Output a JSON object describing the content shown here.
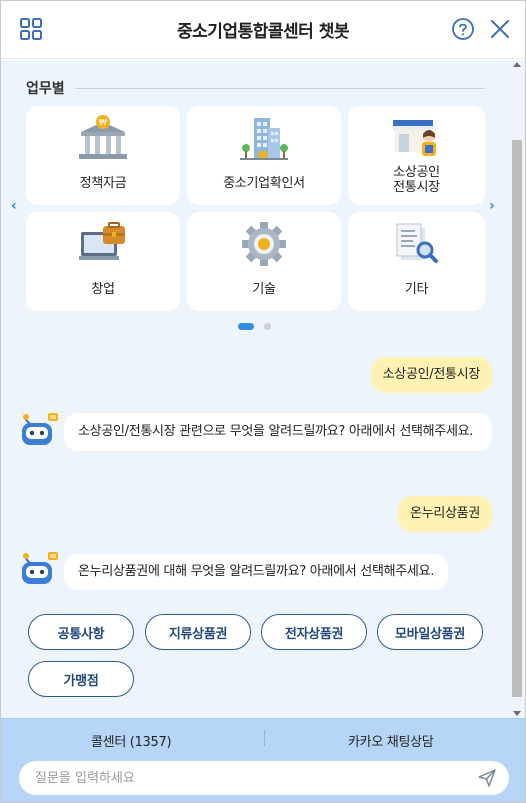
{
  "header": {
    "title": "중소기업통합콜센터 챗봇",
    "menu_icon": "grid-icon",
    "help_icon": "help-circle-icon",
    "close_icon": "close-icon"
  },
  "category": {
    "title": "업무별",
    "cards": [
      {
        "label": "정책자금",
        "icon": "bank-icon"
      },
      {
        "label": "중소기업확인서",
        "icon": "building-icon"
      },
      {
        "label": "소상공인\n전통시장",
        "icon": "shop-icon"
      },
      {
        "label": "창업",
        "icon": "briefcase-computer-icon"
      },
      {
        "label": "기술",
        "icon": "gear-icon"
      },
      {
        "label": "기타",
        "icon": "document-search-icon"
      }
    ]
  },
  "messages": [
    {
      "from": "user",
      "text": "소상공인/전통시장"
    },
    {
      "from": "bot",
      "text": "소상공인/전통시장 관련으로 무엇을 알려드릴까요? 아래에서 선택해주세요."
    },
    {
      "from": "user",
      "text": "온누리상품권"
    },
    {
      "from": "bot",
      "text": "온누리상품권에 대해 무엇을 알려드릴까요? 아래에서 선택해주세요."
    }
  ],
  "options": [
    "공통사항",
    "지류상품권",
    "전자상품권",
    "모바일상품권",
    "가맹점"
  ],
  "footer": {
    "call_center": "콜센터 (1357)",
    "kakao": "카카오 채팅상담",
    "input_placeholder": "질문을 입력하세요",
    "send_icon": "send-icon"
  },
  "colors": {
    "accent": "#2f8ee6",
    "user_bubble": "#fff2b3",
    "chat_bg": "#eef4fc",
    "footer_bg": "#b7d6f7",
    "chip_border": "#2e5b9c"
  }
}
